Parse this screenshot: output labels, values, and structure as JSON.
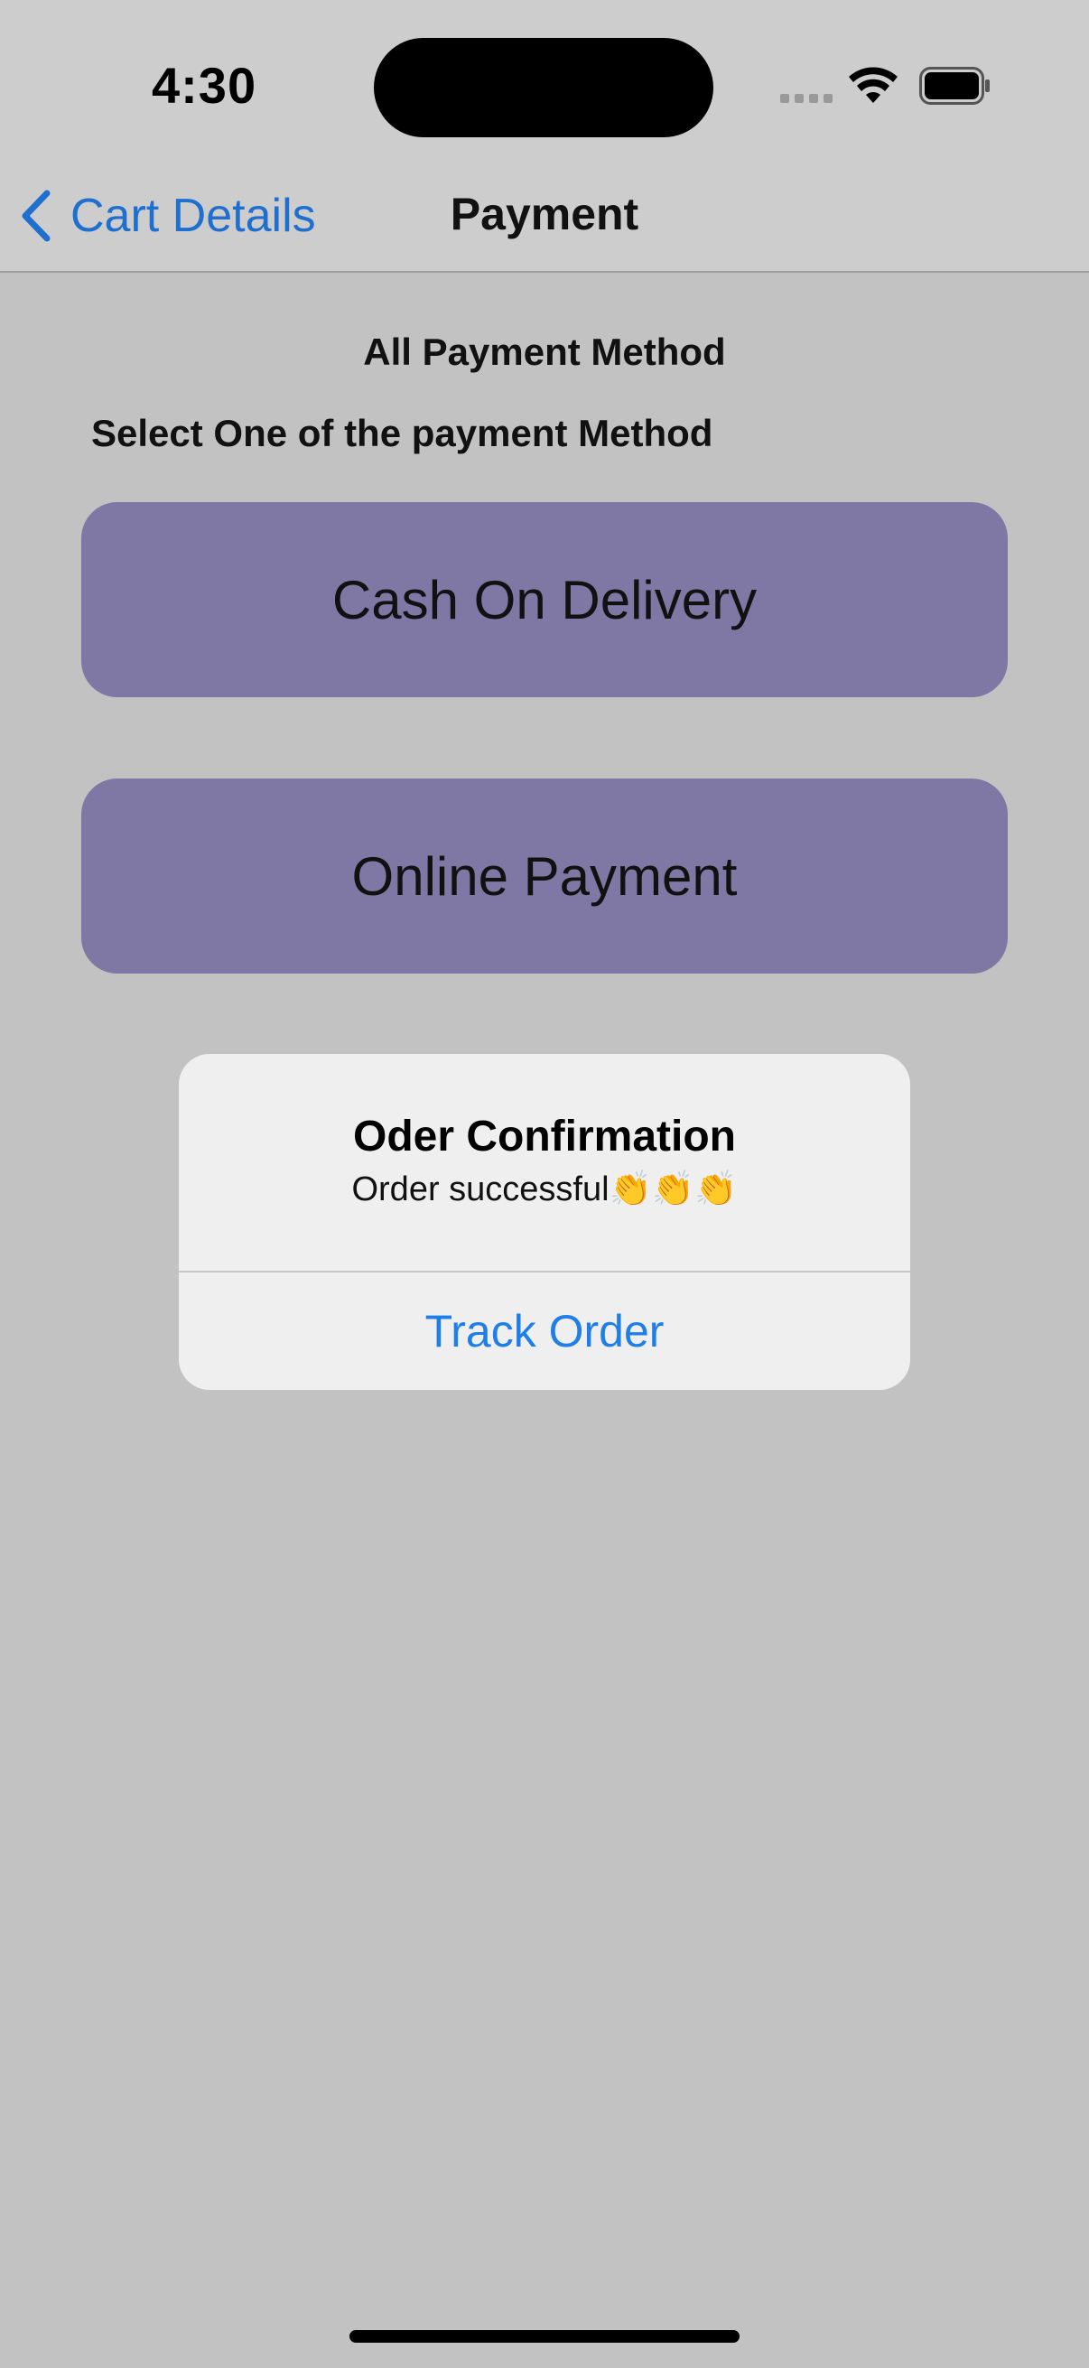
{
  "status_bar": {
    "time": "4:30",
    "icons": [
      "cellular-signal-icon",
      "wifi-icon",
      "battery-icon"
    ]
  },
  "nav": {
    "back_label": "Cart Details",
    "title": "Payment"
  },
  "content": {
    "title": "All Payment Method",
    "subtitle": "Select One of the payment Method",
    "options": [
      {
        "label": "Cash On Delivery"
      },
      {
        "label": "Online Payment"
      }
    ]
  },
  "alert": {
    "title": "Oder Confirmation",
    "message": "Order successful👏👏👏",
    "action_label": "Track Order"
  },
  "colors": {
    "background": "#c2c2c2",
    "bar_background": "#cdcdcd",
    "accent": "#1f6fcf",
    "alert_action": "#1f7ee8",
    "option_button": "#7f77a4",
    "alert_background": "#efefef"
  }
}
